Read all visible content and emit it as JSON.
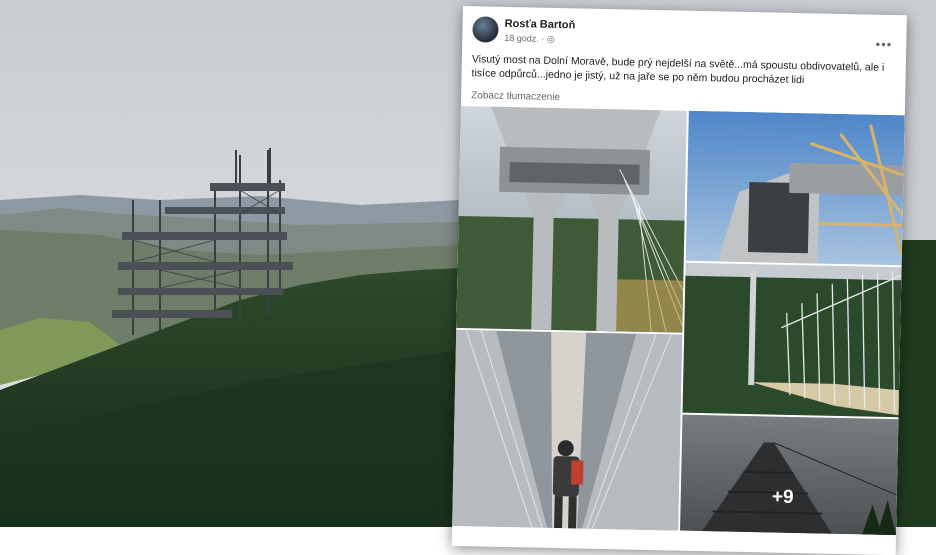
{
  "post": {
    "author": "Rosťa Bartoň",
    "time": "18 godz.",
    "audience_icon": "globe-icon",
    "menu_icon": "more-options-icon",
    "text": "Visutý most na Dolní Moravě, bude prý nejdelší na světě...má spoustu obdivovatelů, ale i tisíce odpůrců...jedno je jistý, už na jaře se po něm budou procházet lidi",
    "translate_label": "Zobacz tłumaczenie",
    "more_photos": "+9"
  },
  "colors": {
    "sky": "#c7ccd1",
    "forest": "#1f3a1e",
    "card": "#ffffff",
    "secondary_text": "#65676b"
  }
}
